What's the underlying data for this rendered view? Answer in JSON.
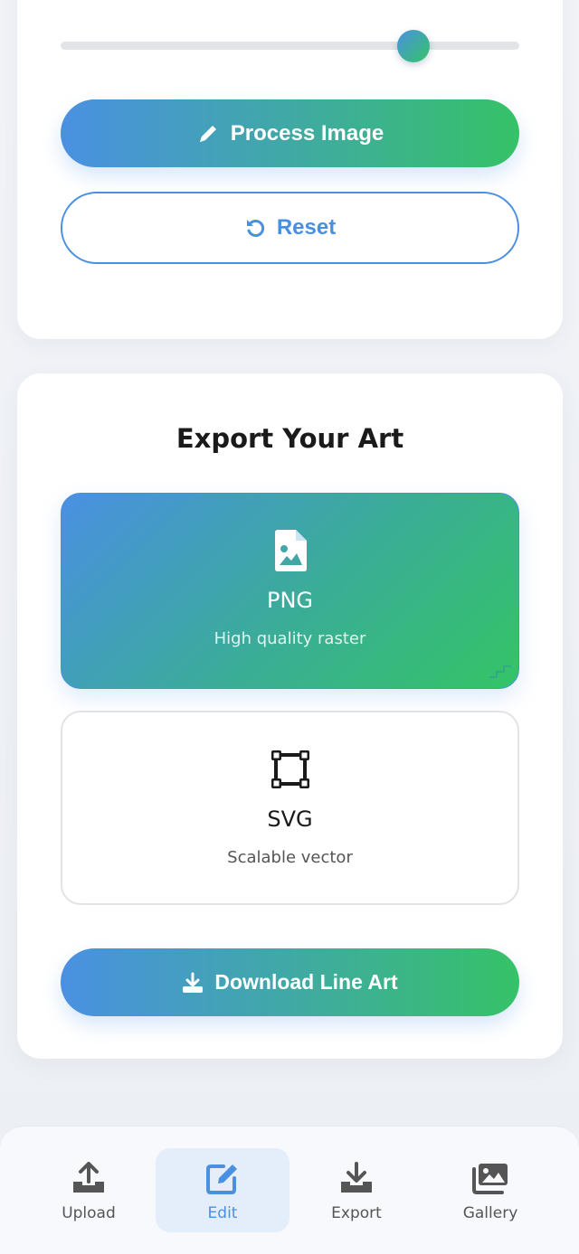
{
  "editor": {
    "slider_value": 0.77,
    "process_label": "Process Image",
    "reset_label": "Reset"
  },
  "export": {
    "title": "Export Your Art",
    "formats": [
      {
        "name": "PNG",
        "desc": "High quality raster",
        "icon": "file-image-icon",
        "selected": true
      },
      {
        "name": "SVG",
        "desc": "Scalable vector",
        "icon": "vector-square-icon",
        "selected": false
      }
    ],
    "download_label": "Download Line Art"
  },
  "nav": {
    "items": [
      {
        "label": "Upload",
        "icon": "upload-icon",
        "active": false
      },
      {
        "label": "Edit",
        "icon": "edit-icon",
        "active": true
      },
      {
        "label": "Export",
        "icon": "download-icon",
        "active": false
      },
      {
        "label": "Gallery",
        "icon": "images-icon",
        "active": false
      }
    ]
  },
  "colors": {
    "accent_blue": "#4a90e2",
    "accent_green": "#34c466",
    "background": "#eef1f6"
  }
}
